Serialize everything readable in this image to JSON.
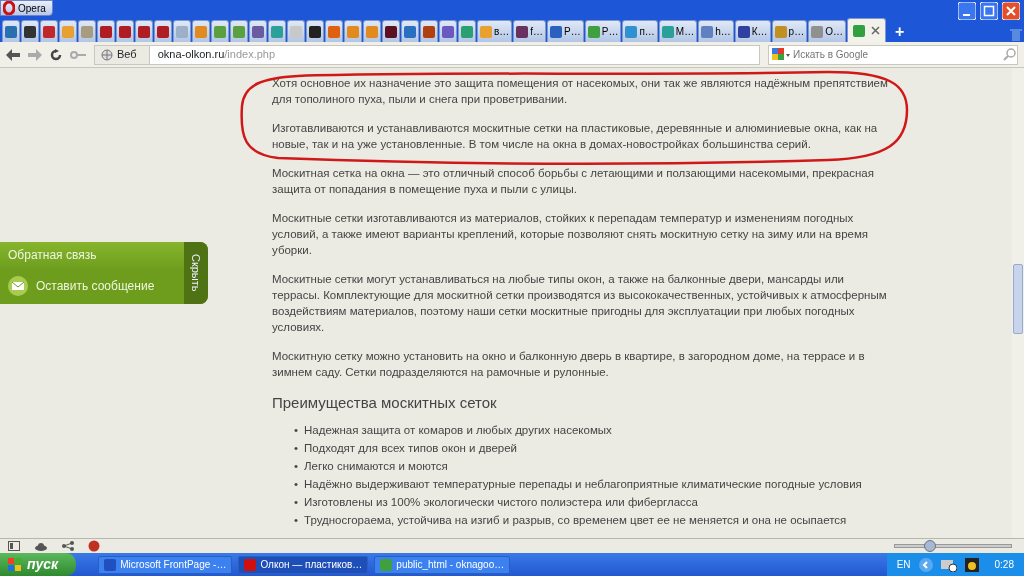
{
  "window": {
    "title": "Opera"
  },
  "tabs": [
    {
      "color": "#2a6fb0",
      "selected": false
    },
    {
      "color": "#333333",
      "selected": false
    },
    {
      "color": "#c0282c",
      "selected": false
    },
    {
      "color": "#e8a030",
      "selected": false
    },
    {
      "color": "#a89c80",
      "selected": false
    },
    {
      "color": "#b01c24",
      "selected": false
    },
    {
      "color": "#b01c24",
      "selected": false
    },
    {
      "color": "#b01c24",
      "selected": false
    },
    {
      "color": "#b01c24",
      "selected": false
    },
    {
      "color": "#9cb0c8",
      "selected": false
    },
    {
      "color": "#e08a20",
      "selected": false
    },
    {
      "color": "#5aa040",
      "selected": false
    },
    {
      "color": "#5aa040",
      "selected": false
    },
    {
      "color": "#6a5aa0",
      "selected": false
    },
    {
      "color": "#2aa098",
      "selected": false
    },
    {
      "color": "#c8c8c8",
      "selected": false
    },
    {
      "color": "#222222",
      "selected": false
    },
    {
      "color": "#e06010",
      "selected": false
    },
    {
      "color": "#e08a20",
      "selected": false
    },
    {
      "color": "#e08a20",
      "selected": false
    },
    {
      "color": "#5a1020",
      "selected": false
    },
    {
      "color": "#2a70c0",
      "selected": false
    },
    {
      "color": "#b04010",
      "selected": false
    },
    {
      "color": "#6a5ac0",
      "selected": false
    },
    {
      "color": "#2aa070",
      "selected": false
    },
    {
      "label": "в…",
      "color": "#e8a030",
      "selected": false
    },
    {
      "label": "f…",
      "color": "#6a3060",
      "selected": false
    },
    {
      "label": "Р…",
      "color": "#2a60c0",
      "selected": false
    },
    {
      "label": "Р…",
      "color": "#40a040",
      "selected": false
    },
    {
      "label": "п…",
      "color": "#3090d0",
      "selected": false
    },
    {
      "label": "М…",
      "color": "#2aa098",
      "selected": false
    },
    {
      "label": "h…",
      "color": "#6080c0",
      "selected": false
    },
    {
      "label": "К…",
      "color": "#3040a0",
      "selected": false
    },
    {
      "label": "р…",
      "color": "#c09020",
      "selected": false
    },
    {
      "label": "О…",
      "color": "#909090",
      "selected": false
    },
    {
      "color": "#30a040",
      "selected": true,
      "closable": true
    }
  ],
  "new_tab": "+",
  "address_bar": {
    "badge": "Веб",
    "url_host": "okna-olkon.ru",
    "url_path": "/index.php",
    "search_placeholder": "Искать в Google"
  },
  "feedback_widget": {
    "title": "Обратная связь",
    "action": "Оставить сообщение",
    "hide": "Скрыть"
  },
  "content": {
    "paragraphs": [
      "Хотя основное их назначение это защита помещения от насекомых, они так же являются надёжным препятствием для тополиного пуха, пыли и снега при проветривании.",
      "Изготавливаются и устанавливаются москитные сетки на пластиковые, деревянные и алюминиевые окна, как на новые, так и на уже установленные. В том числе на окна в домах-новостройках большинства серий.",
      "Москитная сетка на окна — это отличный способ борьбы с летающими и ползающими насекомыми, прекрасная защита от попадания в помещение пуха и пыли с улицы.",
      "Москитные сетки изготавливаются из материалов, стойких к перепадам температур и изменениям погодных условий, а также имеют варианты креплений, которые позволяют снять москитную сетку на зиму или на время уборки.",
      "Москитные сетки могут устанавливаться на любые типы окон, а также на балконные двери, мансарды или террасы. Комплектующие для москитной сетки производятся из высококачественных, устойчивых к атмосферным воздействиям материалов, поэтому наши сетки москитные пригодны для эксплуатации при любых погодных условиях.",
      "Москитную сетку можно установить на окно и балконную дверь в квартире, в загородном доме, на террасе и в зимнем саду. Сетки подразделяются на рамочные и рулонные."
    ],
    "heading": "Преимущества москитных сеток",
    "list_marker": "•",
    "list": [
      "Надежная защита от комаров и любых других насекомых",
      "Подходят для всех типов окон и дверей",
      "Легко снимаются и моются",
      "Надёжно выдерживают температурные перепады и неблагоприятные климатические погодные условия",
      "Изготовлены из 100% экологически чистого полиэстера или фибергласса",
      "Трудносгораема, устойчива на изгиб и разрыв, со временем цвет ее не меняется и она не осыпается"
    ]
  },
  "status_bar": {
    "zoom": {
      "level": 0.3
    }
  },
  "taskbar": {
    "start": "пуск",
    "buttons": [
      {
        "label": "Microsoft FrontPage -…",
        "color": "#2050c0",
        "selected": false
      },
      {
        "label": "Олкон — пластиков…",
        "color": "#d01010",
        "selected": true
      },
      {
        "label": "public_html - oknagoo…",
        "color": "#40a040",
        "selected": false
      }
    ],
    "language": "EN",
    "time": "0:28"
  }
}
